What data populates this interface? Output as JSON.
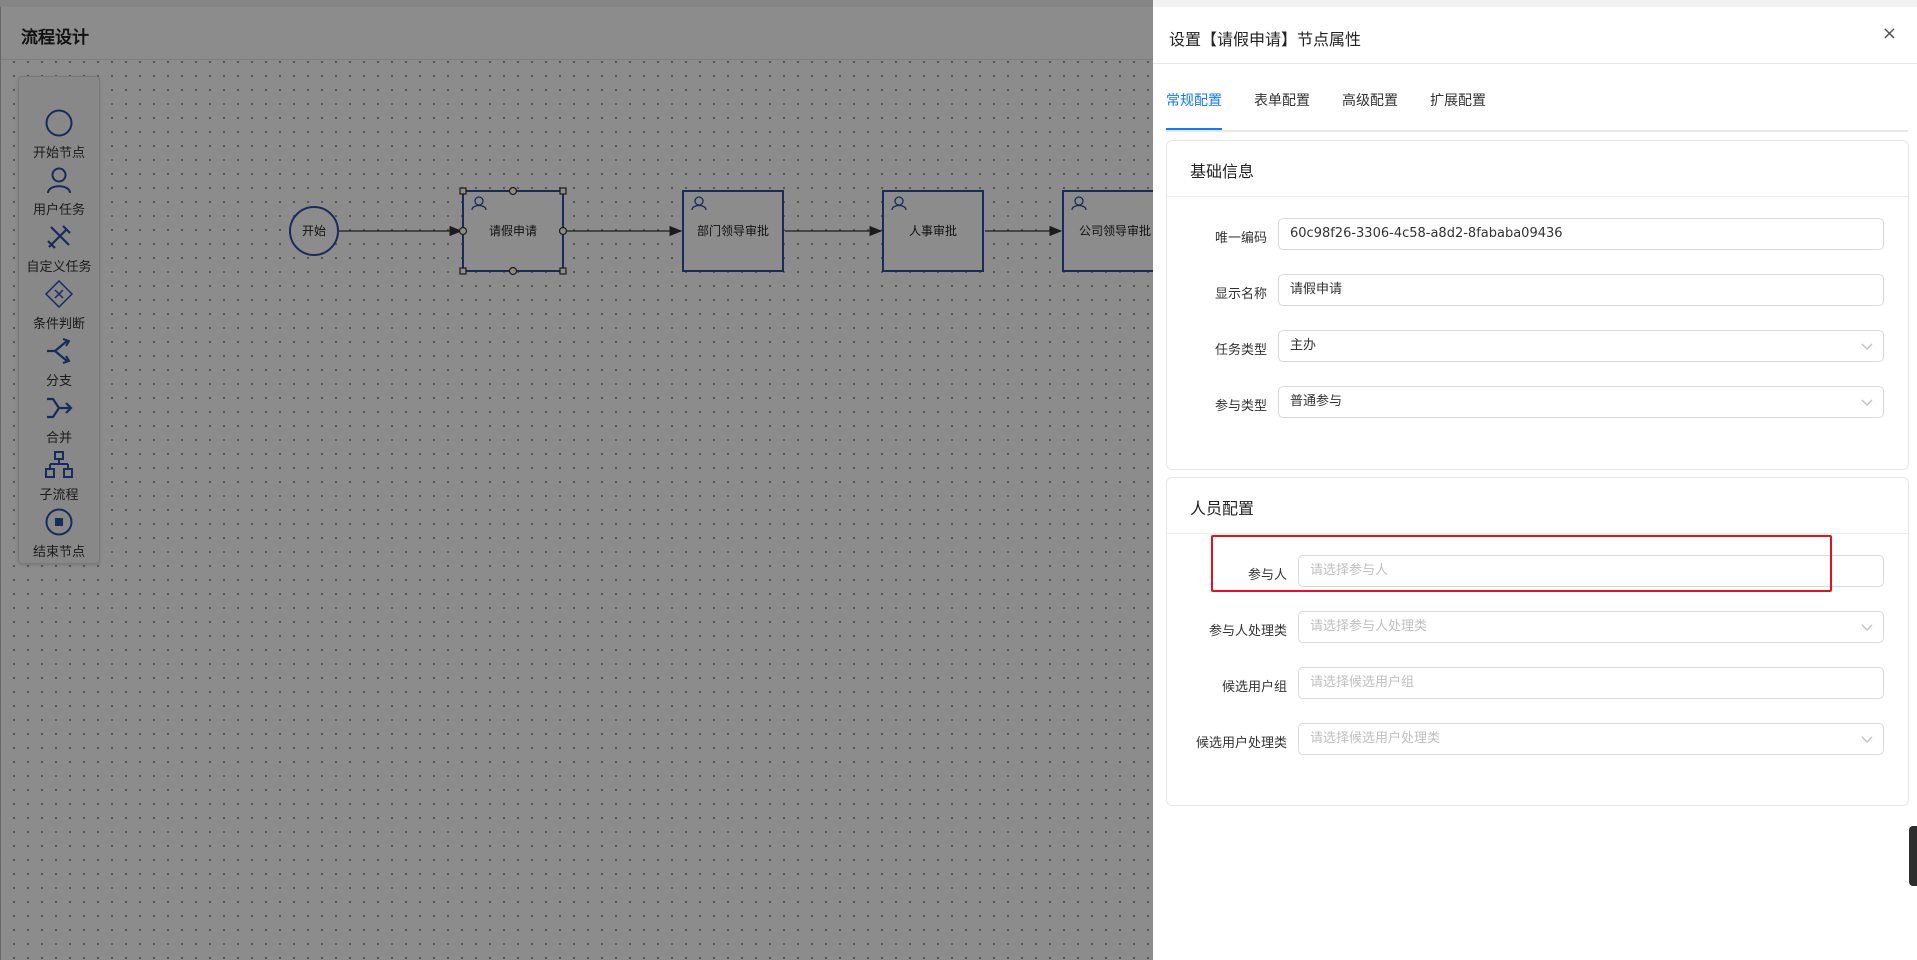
{
  "designer": {
    "title": "流程设计",
    "palette": [
      {
        "label": "开始节点",
        "icon": "circle-icon"
      },
      {
        "label": "用户任务",
        "icon": "user-icon"
      },
      {
        "label": "自定义任务",
        "icon": "tools-icon"
      },
      {
        "label": "条件判断",
        "icon": "diamond-x-icon"
      },
      {
        "label": "分支",
        "icon": "fork-icon"
      },
      {
        "label": "合并",
        "icon": "merge-icon"
      },
      {
        "label": "子流程",
        "icon": "subprocess-icon"
      },
      {
        "label": "结束节点",
        "icon": "stop-circle-icon"
      }
    ],
    "nodes": {
      "start": "开始",
      "apply": "请假申请",
      "dept": "部门领导审批",
      "hr": "人事审批",
      "company": "公司领导审批"
    }
  },
  "drawer": {
    "title": "设置【请假申请】节点属性",
    "close": "×",
    "tabs": [
      "常规配置",
      "表单配置",
      "高级配置",
      "扩展配置"
    ],
    "active_tab": "常规配置",
    "basic": {
      "title": "基础信息",
      "fields": [
        {
          "label": "唯一编码",
          "value": "60c98f26-3306-4c58-a8d2-8fababa09436",
          "type": "input"
        },
        {
          "label": "显示名称",
          "value": "请假申请",
          "type": "input"
        },
        {
          "label": "任务类型",
          "value": "主办",
          "type": "select"
        },
        {
          "label": "参与类型",
          "value": "普通参与",
          "type": "select"
        }
      ]
    },
    "personnel": {
      "title": "人员配置",
      "fields": [
        {
          "label": "参与人",
          "placeholder": "请选择参与人",
          "type": "input"
        },
        {
          "label": "参与人处理类",
          "placeholder": "请选择参与人处理类",
          "type": "select"
        },
        {
          "label": "候选用户组",
          "placeholder": "请选择候选用户组",
          "type": "input"
        },
        {
          "label": "候选用户处理类",
          "placeholder": "请选择候选用户处理类",
          "type": "select"
        }
      ]
    }
  },
  "colors": {
    "node": "#2b4fa8",
    "accent": "#1677ff",
    "highlight": "#e8101b"
  }
}
